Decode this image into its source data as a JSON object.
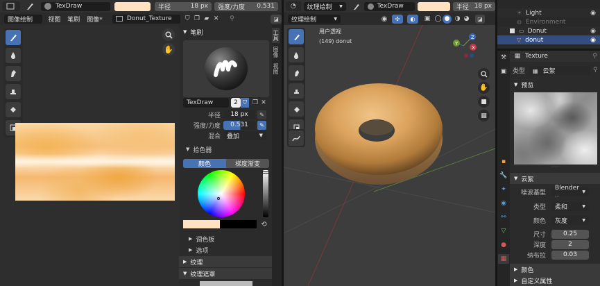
{
  "left_editor": {
    "mode_label": "图像绘制",
    "menus": [
      "视图",
      "笔刷",
      "图像*"
    ],
    "image_name": "Donut_Texture"
  },
  "top_toolbar": {
    "brush_name": "TexDraw",
    "radius_label": "半径",
    "radius_value": "18 px",
    "strength_label": "强度/力度",
    "strength_value": "0.531",
    "color_hex": "#ffe2c2"
  },
  "brush_panel": {
    "title": "笔刷",
    "brush_name": "TexDraw",
    "users": "2",
    "radius_label": "半径",
    "radius_value": "18 px",
    "strength_label": "强度/力度",
    "strength_value": "0.531",
    "blend_label": "混合",
    "blend_value": "叠加",
    "color_picker_title": "拾色器",
    "tab_color": "颜色",
    "tab_gradient": "梯度渐变",
    "palette_label": "调色板",
    "options_label": "选项",
    "texture_label": "纹理",
    "texture_mask_label": "纹理遮罩"
  },
  "side_tabs": [
    "工具",
    "图像",
    "视图"
  ],
  "viewport": {
    "mode_label": "纹理绘制",
    "brush_name": "TexDraw",
    "radius_label": "半径",
    "radius_value": "18 px",
    "perspective_label": "用户透视",
    "object_label": "(149) donut"
  },
  "outliner": {
    "items": [
      {
        "name": "Light",
        "dim": false
      },
      {
        "name": "Environment",
        "dim": true
      },
      {
        "name": "Donut",
        "dim": false
      },
      {
        "name": "donut",
        "dim": false
      }
    ]
  },
  "properties": {
    "texture_name": "Texture",
    "type_label": "类型",
    "type_value": "云絮",
    "preview_label": "预览",
    "clouds_title": "云絮",
    "noise_basis_label": "噪波基型",
    "noise_basis_value": "Blender ..",
    "noise_type_label": "类型",
    "noise_type_value": "柔和",
    "color_label": "颜色",
    "color_value": "灰度",
    "size_label": "尺寸",
    "size_value": "0.25",
    "depth_label": "深度",
    "depth_value": "2",
    "nabla_label": "纳布拉",
    "nabla_value": "0.03",
    "color_section": "颜色",
    "custom_props": "自定义属性"
  }
}
